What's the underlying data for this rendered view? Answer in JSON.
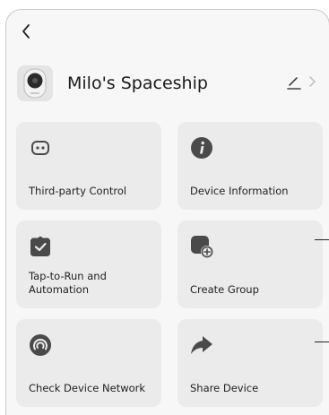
{
  "nav": {
    "back_icon": "chevron-left-icon"
  },
  "device": {
    "name": "Milo's Spaceship",
    "avatar_icon": "camera-device-icon",
    "edit_icon": "pencil-icon",
    "open_icon": "chevron-right-icon"
  },
  "cards": [
    {
      "label": "Third-party Control",
      "icon": "controller-icon"
    },
    {
      "label": "Device Information",
      "icon": "info-icon"
    },
    {
      "label": "Tap-to-Run and Automation",
      "icon": "shield-check-icon"
    },
    {
      "label": "Create Group",
      "icon": "add-group-icon"
    },
    {
      "label": "Check Device Network",
      "icon": "network-signal-icon"
    },
    {
      "label": "Share Device",
      "icon": "share-arrow-icon"
    }
  ],
  "colors": {
    "card_bg": "#ebebeb",
    "icon": "#4a4a4a",
    "page_bg": "#f7f7f7"
  }
}
